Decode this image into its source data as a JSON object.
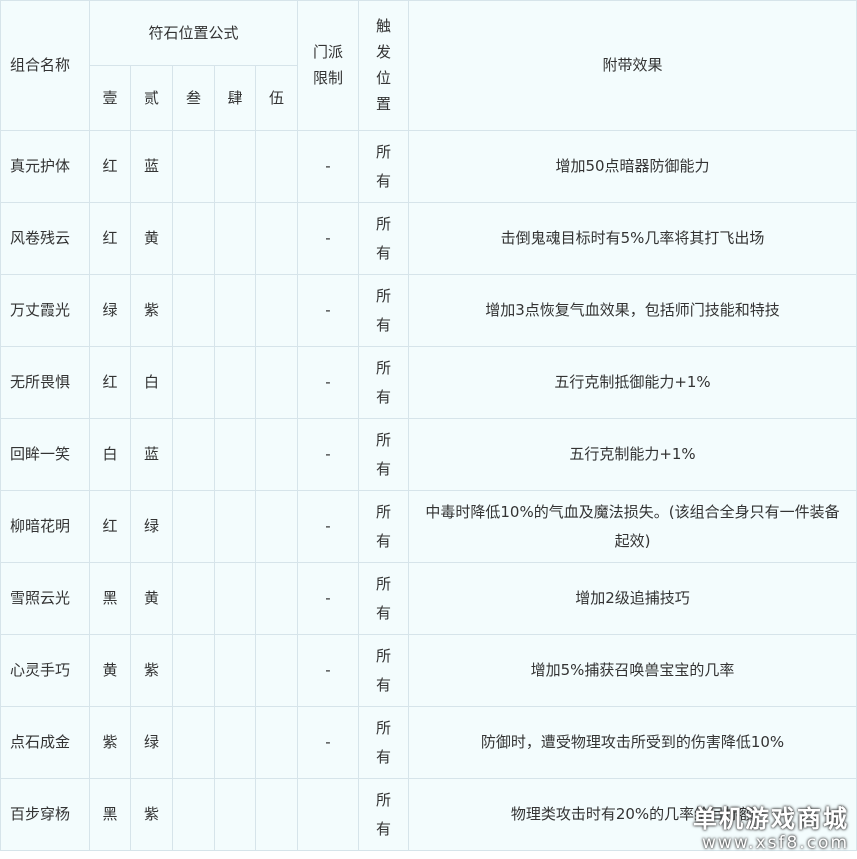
{
  "header": {
    "combo_name": "组合名称",
    "formula": "符石位置公式",
    "pos1": "壹",
    "pos2": "贰",
    "pos3": "叁",
    "pos4": "肆",
    "pos5": "伍",
    "school_limit": "门派限制",
    "trigger_pos": "触发位置",
    "effect": "附带效果"
  },
  "rows": [
    {
      "name": "真元护体",
      "p1": "红",
      "p2": "蓝",
      "p3": "",
      "p4": "",
      "p5": "",
      "school": "-",
      "trigger": "所有",
      "effect": "增加50点暗器防御能力"
    },
    {
      "name": "风卷残云",
      "p1": "红",
      "p2": "黄",
      "p3": "",
      "p4": "",
      "p5": "",
      "school": "-",
      "trigger": "所有",
      "effect": "击倒鬼魂目标时有5%几率将其打飞出场"
    },
    {
      "name": "万丈霞光",
      "p1": "绿",
      "p2": "紫",
      "p3": "",
      "p4": "",
      "p5": "",
      "school": "-",
      "trigger": "所有",
      "effect": "增加3点恢复气血效果，包括师门技能和特技"
    },
    {
      "name": "无所畏惧",
      "p1": "红",
      "p2": "白",
      "p3": "",
      "p4": "",
      "p5": "",
      "school": "-",
      "trigger": "所有",
      "effect": "五行克制抵御能力+1%"
    },
    {
      "name": "回眸一笑",
      "p1": "白",
      "p2": "蓝",
      "p3": "",
      "p4": "",
      "p5": "",
      "school": "-",
      "trigger": "所有",
      "effect": "五行克制能力+1%"
    },
    {
      "name": "柳暗花明",
      "p1": "红",
      "p2": "绿",
      "p3": "",
      "p4": "",
      "p5": "",
      "school": "-",
      "trigger": "所有",
      "effect": "中毒时降低10%的气血及魔法损失。(该组合全身只有一件装备起效)"
    },
    {
      "name": "雪照云光",
      "p1": "黑",
      "p2": "黄",
      "p3": "",
      "p4": "",
      "p5": "",
      "school": "-",
      "trigger": "所有",
      "effect": "增加2级追捕技巧"
    },
    {
      "name": "心灵手巧",
      "p1": "黄",
      "p2": "紫",
      "p3": "",
      "p4": "",
      "p5": "",
      "school": "-",
      "trigger": "所有",
      "effect": "增加5%捕获召唤兽宝宝的几率"
    },
    {
      "name": "点石成金",
      "p1": "紫",
      "p2": "绿",
      "p3": "",
      "p4": "",
      "p5": "",
      "school": "-",
      "trigger": "所有",
      "effect": "防御时，遭受物理攻击所受到的伤害降低10%"
    },
    {
      "name": "百步穿杨",
      "p1": "黑",
      "p2": "紫",
      "p3": "",
      "p4": "",
      "p5": "",
      "school": "",
      "trigger": "所有",
      "effect": "物理类攻击时有20%的几率给目标额"
    }
  ],
  "watermark": {
    "cn": "单机游戏商城",
    "url": "www.xsf8.com"
  }
}
